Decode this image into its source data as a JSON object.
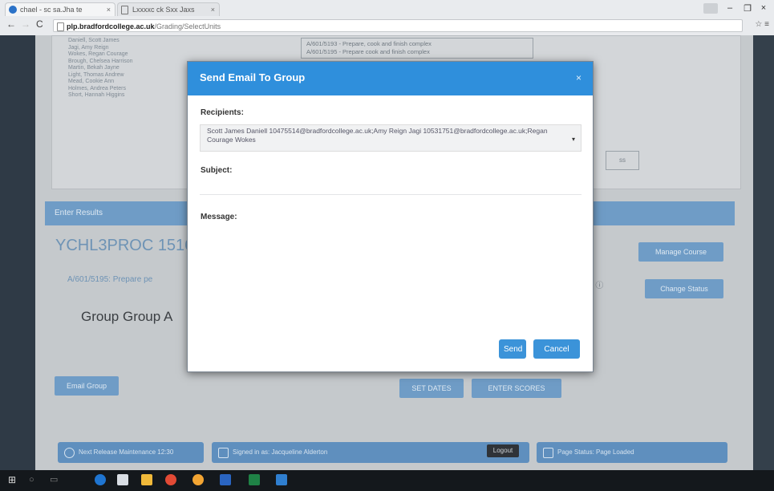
{
  "browser": {
    "tabs": [
      {
        "label": "chael - sc sa.Jha te"
      },
      {
        "label": "Lxxxxc ck Sxx Jaxs"
      }
    ],
    "url_host": "plp.bradfordcollege.ac.uk",
    "url_path": "/Grading/SelectUnits",
    "win_minimize": "–",
    "win_maximize": "❐",
    "win_close": "×"
  },
  "page": {
    "names": [
      "Daniell, Scott James",
      "Jagi, Amy Reign",
      "Wokes, Regan Courage",
      "Brough, Chelsea Harrison",
      "Martin, Bekah Jayne",
      "Light, Thomas Andrew",
      "Mead, Cookie Ann",
      "Holmes, Andrea Peters",
      "Short, Hannah Higgins"
    ],
    "unit_items": [
      "A/601/5193 - Prepare, cook and finish complex",
      "A/601/5195 - Prepare cook and finish complex"
    ],
    "side_box_label": "ss",
    "enter_results": "Enter Results",
    "course_code": "YCHL3PROC 1516",
    "unit_link": "A/601/5195: Prepare pe",
    "pct_text": "5 ⓘ",
    "group_title": "Group Group A",
    "manage_course": "Manage Course",
    "change_status": "Change Status",
    "email_group": "Email Group",
    "set_dates": "SET DATES",
    "enter_scores": "ENTER SCORES",
    "footer_left": "Next Release Maintenance 12:30",
    "footer_mid": "Signed in as: Jacqueline Alderton",
    "logout": "Logout",
    "footer_right": "Page Status: Page Loaded"
  },
  "modal": {
    "title": "Send Email To Group",
    "close": "×",
    "recipients_label": "Recipients:",
    "recipients_value": "Scott James Daniell 10475514@bradfordcollege.ac.uk;Amy Reign Jagi 10531751@bradfordcollege.ac.uk;Regan Courage Wokes",
    "subject_label": "Subject:",
    "subject_value": "",
    "message_label": "Message:",
    "message_value": "",
    "send": "Send",
    "cancel": "Cancel"
  },
  "colors": {
    "modal_header": "#2f8fdc",
    "button": "#3b93d9"
  }
}
